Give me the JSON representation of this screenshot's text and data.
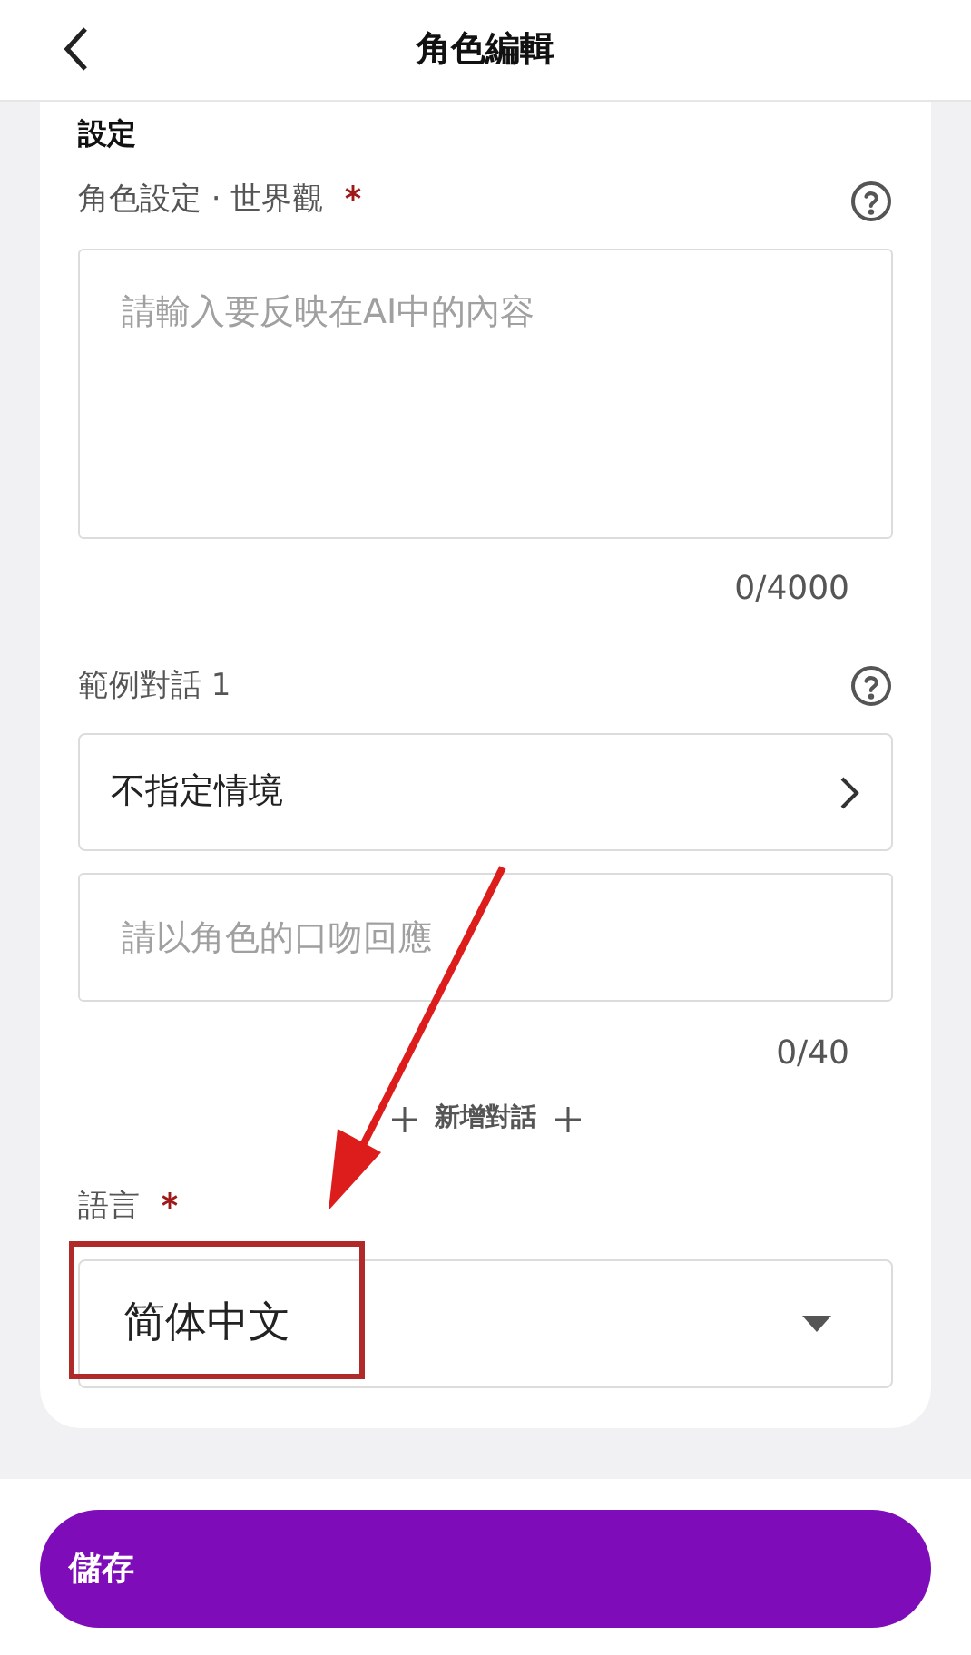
{
  "header": {
    "title": "角色編輯"
  },
  "section_title": "設定",
  "world": {
    "label": "角色設定 · 世界觀",
    "required": true,
    "placeholder": "請輸入要反映在AI中的內容",
    "counter": "0/4000"
  },
  "dialogs": [
    {
      "label": "範例對話 1",
      "scenario": "不指定情境",
      "placeholder": "請以角色的口吻回應",
      "counter": "0/40"
    }
  ],
  "add_dialog": {
    "label": "新增對話"
  },
  "language": {
    "label": "語言",
    "required": true,
    "value": "简体中文"
  },
  "save_button": {
    "label": "儲存"
  }
}
